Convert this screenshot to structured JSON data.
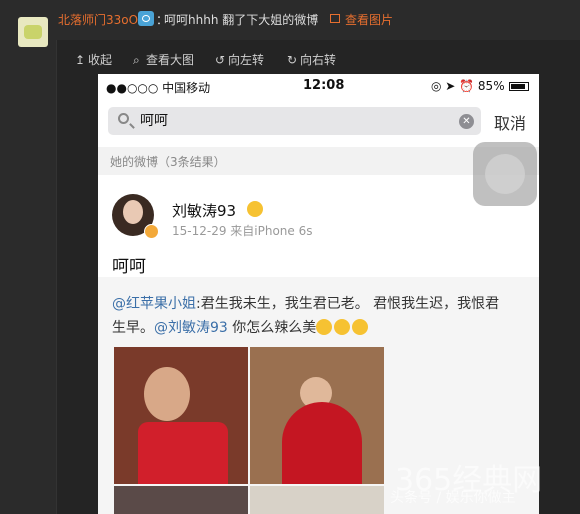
{
  "post": {
    "author": "北落师门33oO",
    "colon": "：",
    "message": "呵呵hhhh 翻了下大姐的微博",
    "view_pic": "查看图片"
  },
  "toolbar": {
    "collapse": "收起",
    "view_large": "查看大图",
    "rotate_left": "向左转",
    "rotate_right": "向右转"
  },
  "phone": {
    "carrier": "●●○○○ 中国移动",
    "time": "12:08",
    "battery": "85%",
    "search_value": "呵呵",
    "cancel": "取消",
    "section": "她的微博（3条结果）",
    "weibo": {
      "name": "刘敏涛93",
      "meta": "15-12-29  来自iPhone 6s",
      "text": "呵呵",
      "repost_mention": "@红苹果小姐",
      "repost_text": ":君生我未生，我生君已老。 君恨我生迟，我恨君生早。",
      "repost_mention2": "@刘敏涛93",
      "repost_text2": " 你怎么辣么美"
    }
  },
  "watermark": {
    "main": "365经典网",
    "sub": "头条号 / 娱乐你做主"
  },
  "colors": {
    "accent": "#e76f2f",
    "link": "#3b6fa8"
  }
}
